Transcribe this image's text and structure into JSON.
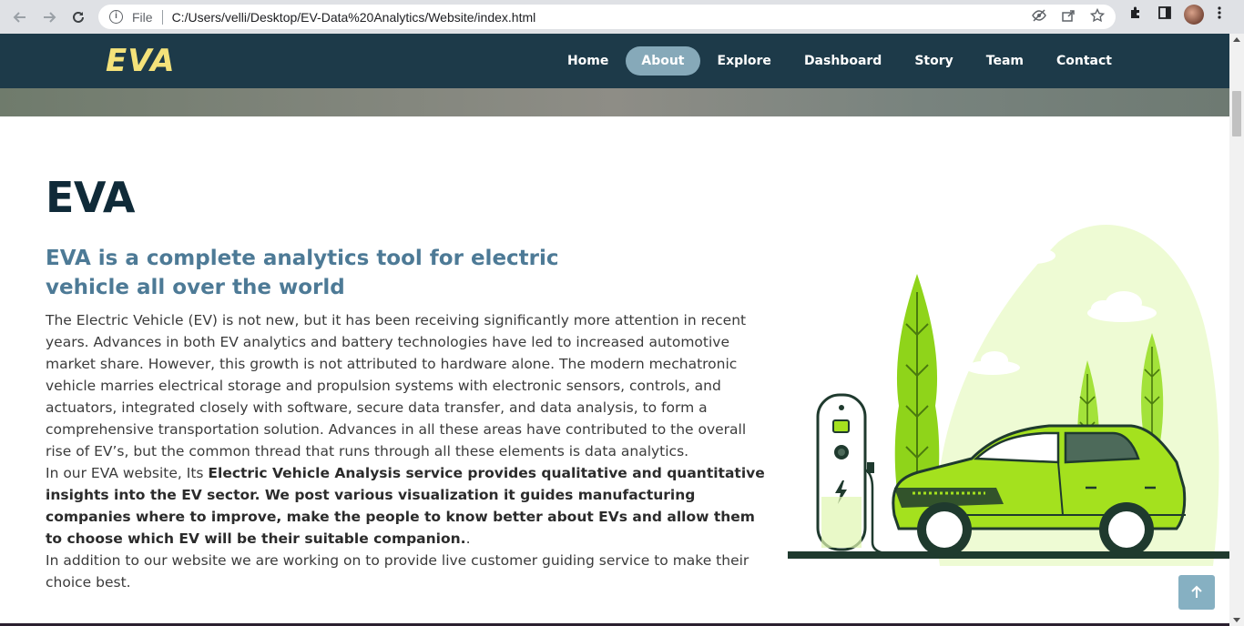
{
  "browser": {
    "scheme_label": "File",
    "url": "C:/Users/velli/Desktop/EV-Data%20Analytics/Website/index.html"
  },
  "site": {
    "logo": "EVA",
    "colors": {
      "navbar_bg": "#1d3a49",
      "logo": "#f4e27a",
      "active_pill": "#86a9b9",
      "accent_green": "#a4e11e"
    },
    "nav": [
      {
        "label": "Home",
        "active": false
      },
      {
        "label": "About",
        "active": true
      },
      {
        "label": "Explore",
        "active": false
      },
      {
        "label": "Dashboard",
        "active": false
      },
      {
        "label": "Story",
        "active": false
      },
      {
        "label": "Team",
        "active": false
      },
      {
        "label": "Contact",
        "active": false
      }
    ]
  },
  "about": {
    "title": "EVA",
    "subtitle": "EVA is a complete analytics tool for electric vehicle all over the world",
    "paragraph1": "The Electric Vehicle (EV) is not new, but it has been receiving significantly more attention in recent years. Advances in both EV analytics and battery technologies have led to increased automotive market share. However, this growth is not attributed to hardware alone. The modern mechatronic vehicle marries electrical storage and propulsion systems with electronic sensors, controls, and actuators, integrated closely with software, secure data transfer, and data analysis, to form a comprehensive transportation solution. Advances in all these areas have contributed to the overall rise of EV’s, but the common thread that runs through all these elements is data analytics.",
    "paragraph2_lead": "In our EVA website, Its ",
    "paragraph2_bold": "Electric Vehicle Analysis service provides qualitative and quantitative insights into the EV sector. We post various visualization it guides manufacturing companies where to improve, make the people to know better about EVs and allow them to choose which EV will be their suitable companion.",
    "paragraph2_end": ".",
    "paragraph3": "In addition to our website we are working on to provide live customer guiding service to make their choice best."
  },
  "icons": {
    "back": "arrow-left-icon",
    "forward": "arrow-right-icon",
    "reload": "reload-icon",
    "info": "info-icon",
    "eye_off": "eye-off-icon",
    "share": "share-icon",
    "star": "star-icon",
    "extensions": "puzzle-icon",
    "sidepanel": "side-panel-icon",
    "menu": "kebab-menu-icon",
    "back_to_top": "arrow-up-icon",
    "illustration": "ev-charging-car-illustration"
  }
}
